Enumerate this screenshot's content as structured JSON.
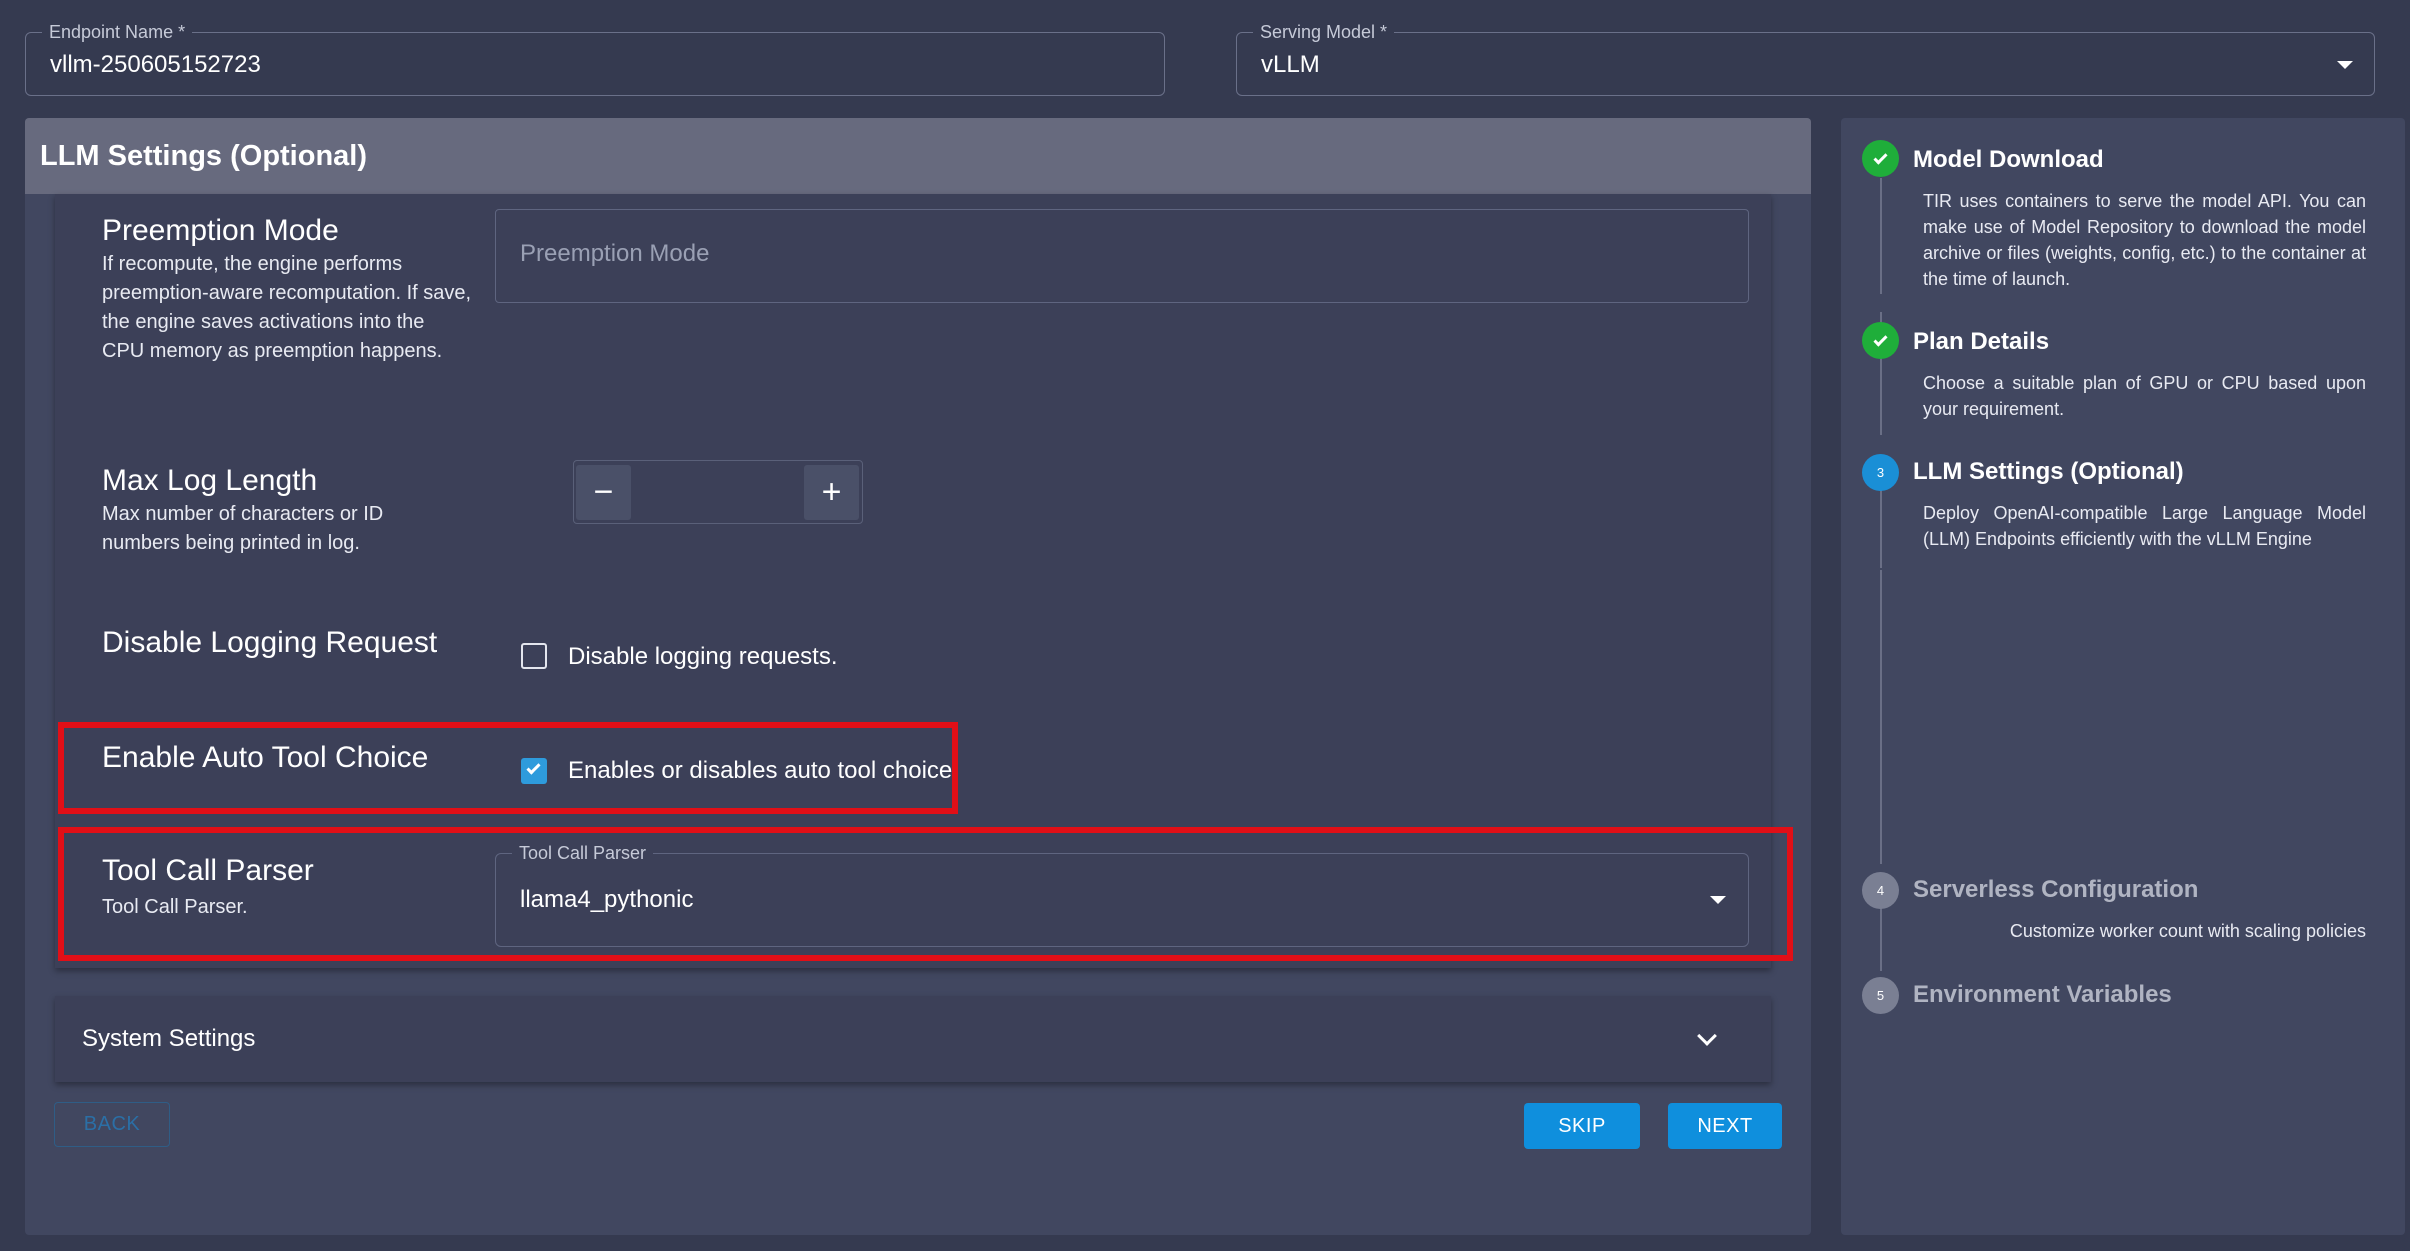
{
  "top_fields": {
    "endpoint_name": {
      "label": "Endpoint Name *",
      "value": "vllm-250605152723"
    },
    "serving_model": {
      "label": "Serving Model *",
      "value": "vLLM"
    }
  },
  "llm_settings": {
    "title": "LLM Settings (Optional)",
    "preemption_mode": {
      "title": "Preemption Mode",
      "description": "If recompute, the engine performs preemption-aware recomputation. If save, the engine saves activations into the CPU memory as preemption happens.",
      "placeholder": "Preemption Mode"
    },
    "max_log_length": {
      "title": "Max Log Length",
      "description": "Max number of characters or ID numbers being printed in log.",
      "value": "",
      "minus_symbol": "−",
      "plus_symbol": "+"
    },
    "disable_logging": {
      "title": "Disable Logging Request",
      "checkbox_label": "Disable logging requests.",
      "checked": false
    },
    "auto_tool_choice": {
      "title": "Enable Auto Tool Choice",
      "checkbox_label": "Enables or disables auto tool choice",
      "checked": true
    },
    "tool_call_parser": {
      "title": "Tool Call Parser",
      "description": "Tool Call Parser.",
      "field_label": "Tool Call Parser",
      "value": "llama4_pythonic"
    },
    "system_settings_label": "System Settings"
  },
  "actions": {
    "back": "BACK",
    "skip": "SKIP",
    "next": "NEXT"
  },
  "steps": [
    {
      "number": "1",
      "title": "Model Download",
      "state": "completed",
      "description": "TIR uses containers to serve the model API. You can make use of Model Repository to download the model archive or files (weights, config, etc.) to the container at the time of launch."
    },
    {
      "number": "2",
      "title": "Plan Details",
      "state": "completed",
      "description": "Choose a suitable plan of GPU or CPU based upon your requirement."
    },
    {
      "number": "3",
      "title": "LLM Settings (Optional)",
      "state": "active",
      "description": "Deploy OpenAI-compatible Large Language Model (LLM) Endpoints efficiently with the vLLM Engine"
    },
    {
      "number": "4",
      "title": "Serverless Configuration",
      "state": "pending",
      "description": "Customize worker count with scaling policies"
    },
    {
      "number": "5",
      "title": "Environment Variables",
      "state": "pending",
      "description": ""
    }
  ],
  "colors": {
    "background": "#353a50",
    "panel": "#414760",
    "accent": "#0f8fdd",
    "success": "#1fae3a",
    "highlight": "#e10f17"
  }
}
